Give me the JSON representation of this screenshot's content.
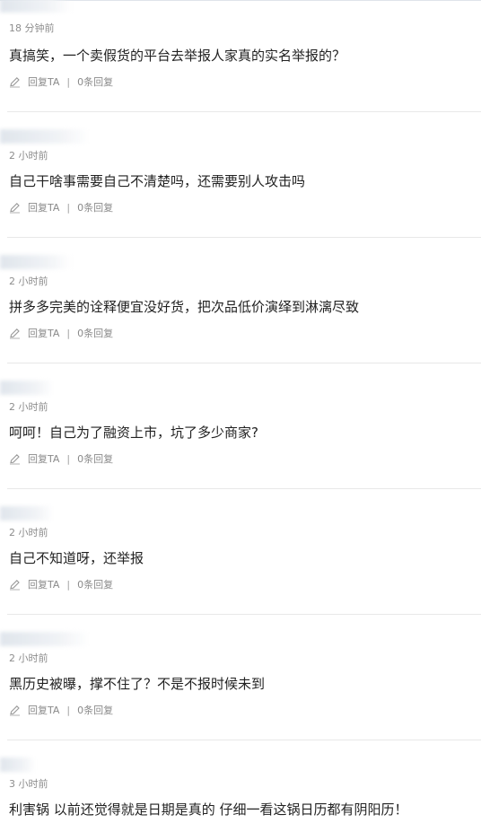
{
  "comments": [
    {
      "time": "18 分钟前",
      "content": "真搞笑，一个卖假货的平台去举报人家真的实名举报的？",
      "reply_label": "回复TA",
      "divider": "|",
      "reply_count": "0条回复"
    },
    {
      "time": "2 小时前",
      "content": "自己干啥事需要自己不清楚吗，还需要别人攻击吗",
      "reply_label": "回复TA",
      "divider": "|",
      "reply_count": "0条回复"
    },
    {
      "time": "2 小时前",
      "content": "拼多多完美的诠释便宜没好货，把次品低价演绎到淋漓尽致",
      "reply_label": "回复TA",
      "divider": "|",
      "reply_count": "0条回复"
    },
    {
      "time": "2 小时前",
      "content": "呵呵！自己为了融资上市，坑了多少商家?",
      "reply_label": "回复TA",
      "divider": "|",
      "reply_count": "0条回复"
    },
    {
      "time": "2 小时前",
      "content": "自己不知道呀，还举报",
      "reply_label": "回复TA",
      "divider": "|",
      "reply_count": "0条回复"
    },
    {
      "time": "2 小时前",
      "content": "黑历史被曝，撑不住了？不是不报时候未到",
      "reply_label": "回复TA",
      "divider": "|",
      "reply_count": "0条回复"
    },
    {
      "time": "3 小时前",
      "content": "利害锅  以前还觉得就是日期是真的  仔细一看这锅日历都有阴阳历！"
    }
  ],
  "colors": {
    "time": "#8d8d8d",
    "content": "#222222",
    "action": "#8a8a8a",
    "separator": "#e8e8e8",
    "username_blur": "#dde3ea"
  },
  "icons": {
    "edit": "pencil-icon"
  }
}
